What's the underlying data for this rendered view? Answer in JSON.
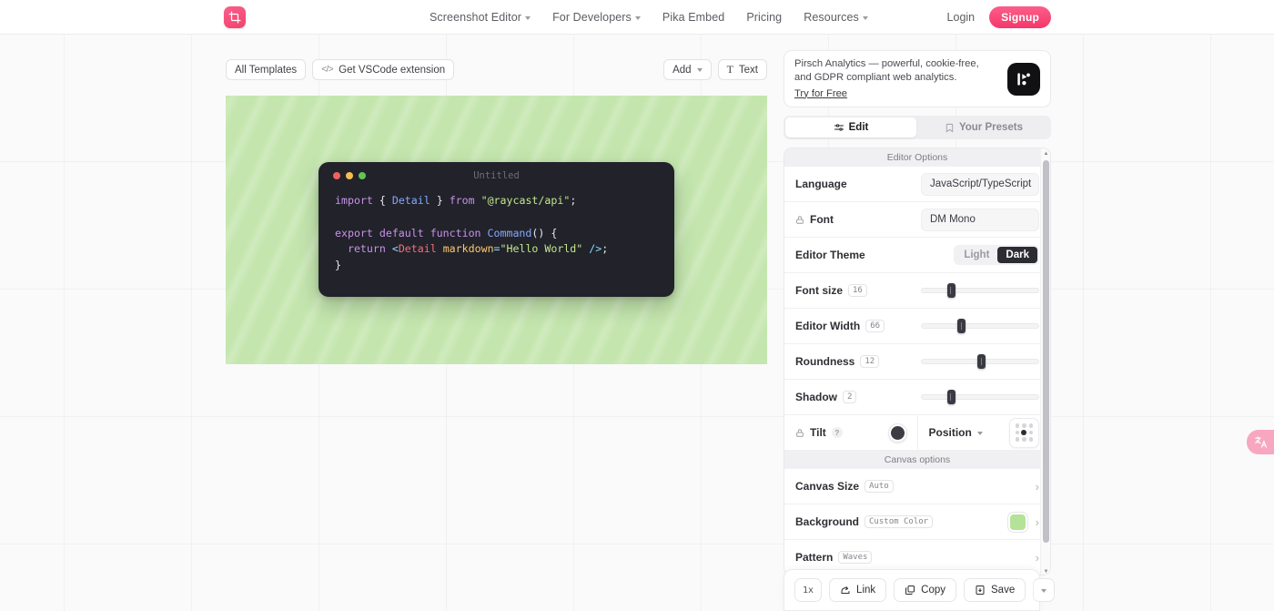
{
  "nav": {
    "logo_icon": "crop-logo-icon",
    "items": [
      {
        "label": "Screenshot Editor",
        "has_caret": true
      },
      {
        "label": "For Developers",
        "has_caret": true
      },
      {
        "label": "Pika Embed",
        "has_caret": false
      },
      {
        "label": "Pricing",
        "has_caret": false
      },
      {
        "label": "Resources",
        "has_caret": true
      }
    ],
    "login_label": "Login",
    "signup_label": "Signup",
    "accent_color": "#f5376b"
  },
  "toolbar": {
    "all_templates_label": "All Templates",
    "vscode_label": "Get VSCode extension",
    "vscode_icon": "</>",
    "add_label": "Add",
    "text_label": "Text",
    "text_icon": "T"
  },
  "canvas": {
    "background_color": "#c4e6ae",
    "pattern": "Waves",
    "window_title": "Untitled",
    "traffic_lights": [
      "#f2615d",
      "#f4bd4f",
      "#61c554"
    ],
    "code_lines": [
      "import { Detail } from \"@raycast/api\";",
      "",
      "export default function Command() {",
      "  return <Detail markdown=\"Hello World\" />;",
      "}"
    ]
  },
  "promo": {
    "text": "Pirsch Analytics — powerful, cookie-free, and GDPR compliant web analytics.",
    "link_label": "Try for Free",
    "logo_icon": "pirsch-logo-icon"
  },
  "tabs": {
    "edit_label": "Edit",
    "edit_icon": "sliders-icon",
    "presets_label": "Your Presets",
    "presets_icon": "bookmark-icon",
    "active": "Edit"
  },
  "editor_options": {
    "section_title": "Editor Options",
    "language_label": "Language",
    "language_value": "JavaScript/TypeScript",
    "font_label": "Font",
    "font_value": "DM Mono",
    "font_locked": true,
    "theme_label": "Editor Theme",
    "theme_light": "Light",
    "theme_dark": "Dark",
    "theme_selected": "Dark",
    "font_size_label": "Font size",
    "font_size_value": "16",
    "font_size_pct": 22,
    "editor_width_label": "Editor Width",
    "editor_width_value": "66",
    "editor_width_pct": 31,
    "roundness_label": "Roundness",
    "roundness_value": "12",
    "roundness_pct": 48,
    "shadow_label": "Shadow",
    "shadow_value": "2",
    "shadow_pct": 22,
    "tilt_label": "Tilt",
    "tilt_locked": true,
    "tilt_help": "?",
    "position_label": "Position",
    "position_selected_index": 4
  },
  "canvas_options": {
    "section_title": "Canvas options",
    "canvas_size_label": "Canvas Size",
    "canvas_size_value": "Auto",
    "background_label": "Background",
    "background_value": "Custom Color",
    "background_color": "#b4e398",
    "pattern_label": "Pattern",
    "pattern_value": "Waves"
  },
  "actions": {
    "scale_label": "1x",
    "link_label": "Link",
    "link_icon": "link-share-icon",
    "copy_label": "Copy",
    "copy_icon": "copy-icon",
    "save_label": "Save",
    "save_icon": "download-icon",
    "more_icon": "chevron-down-icon"
  },
  "translate_widget": {
    "icon": "translate-icon",
    "color": "#f8a7c0"
  }
}
